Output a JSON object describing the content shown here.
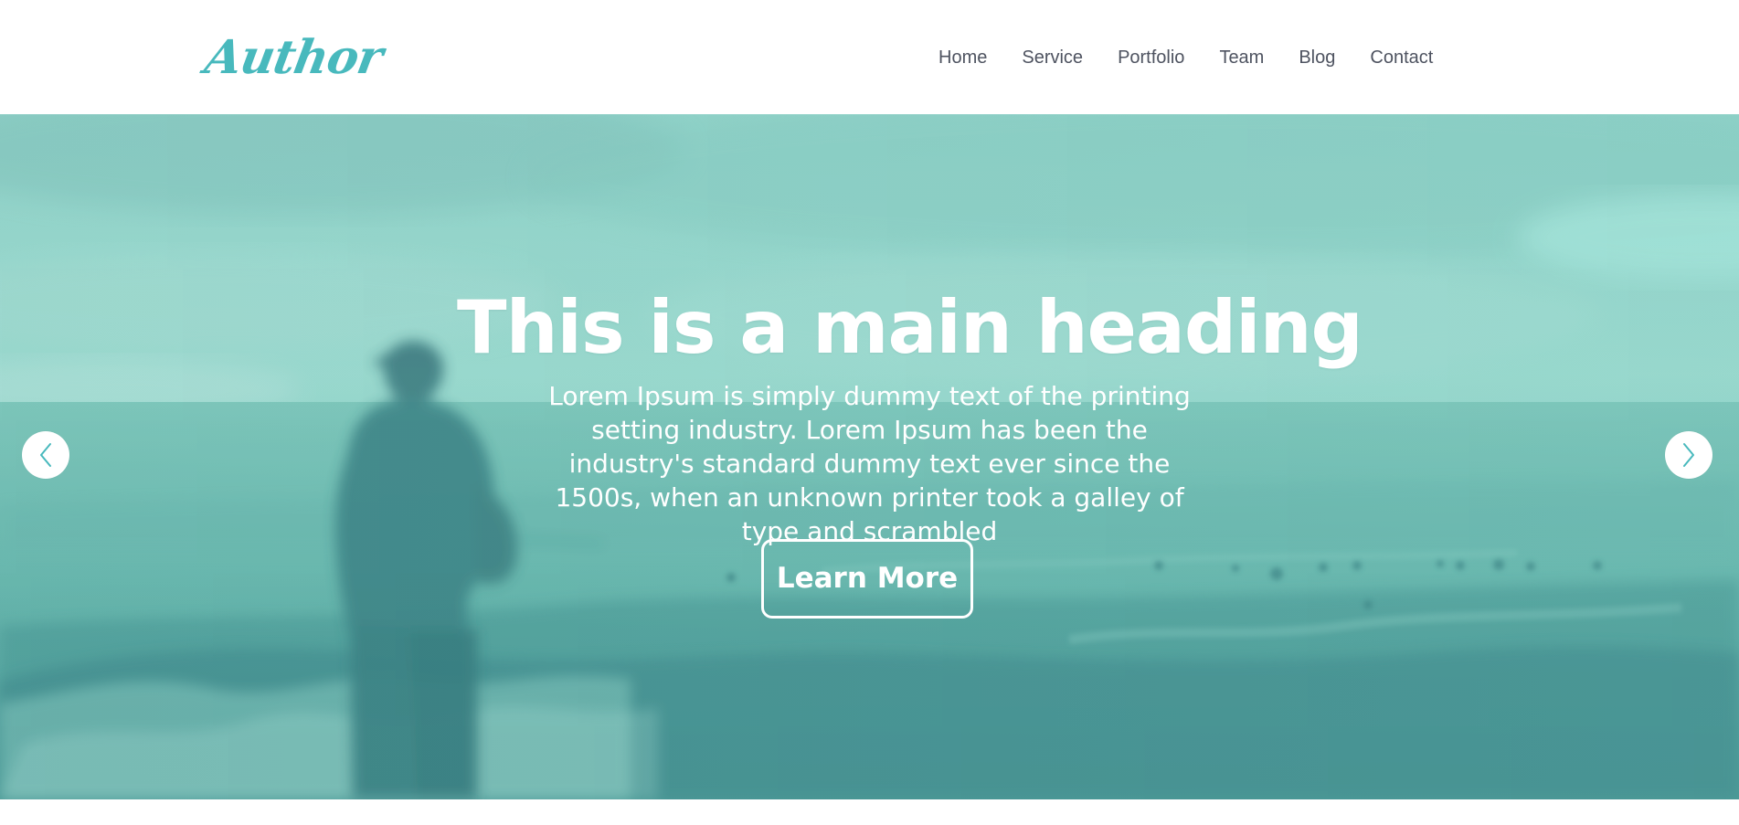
{
  "header": {
    "logo_text": "Author",
    "nav": [
      {
        "label": "Home"
      },
      {
        "label": "Service"
      },
      {
        "label": "Portfolio"
      },
      {
        "label": "Team"
      },
      {
        "label": "Blog"
      },
      {
        "label": "Contact"
      }
    ]
  },
  "hero": {
    "heading": "This is a main heading",
    "description": "Lorem Ipsum is simply dummy text of the printing setting industry. Lorem Ipsum has been the industry's standard dummy text ever since the 1500s, when an unknown printer took a galley of type and scrambled",
    "button_label": "Learn More",
    "previous_icon": "chevron-left-icon",
    "next_icon": "chevron-right-icon"
  },
  "colors": {
    "brand": "#48b9bd",
    "nav_text": "#4e5360",
    "hero_text": "#ffffff",
    "arrow_background": "#ffffff"
  }
}
